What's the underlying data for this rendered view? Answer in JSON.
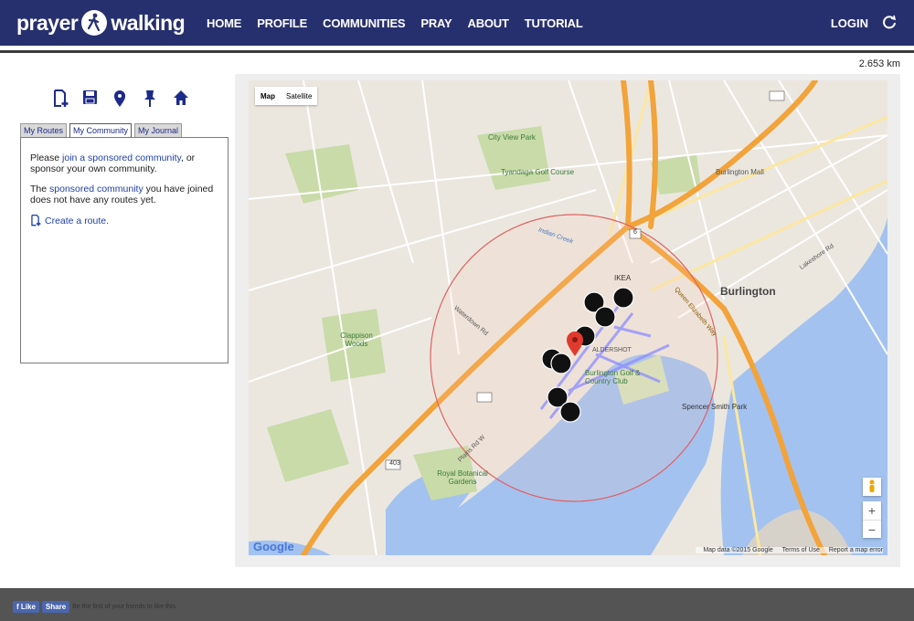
{
  "header": {
    "logo_left": "prayer",
    "logo_right": "walking",
    "nav": [
      "HOME",
      "PROFILE",
      "COMMUNITIES",
      "PRAY",
      "ABOUT",
      "TUTORIAL"
    ],
    "login": "LOGIN"
  },
  "distance": "2.653 km",
  "toolbar": [
    "new-route-icon",
    "save-icon",
    "map-pin-icon",
    "pushpin-icon",
    "home-icon"
  ],
  "tabs": [
    "My Routes",
    "My Community",
    "My Journal"
  ],
  "panel": {
    "p1_before": "Please ",
    "p1_link": "join a sponsored community",
    "p1_after": ", or sponsor your own community.",
    "p2_before": "The ",
    "p2_link": "sponsored community",
    "p2_after": " you have joined does not have any routes yet.",
    "create": "Create a route."
  },
  "map": {
    "type_map": "Map",
    "type_satellite": "Satellite",
    "zoom_in": "+",
    "zoom_out": "−",
    "google": "Google",
    "attribution": {
      "data": "Map data ©2015 Google",
      "terms": "Terms of Use",
      "report": "Report a map error"
    },
    "labels": {
      "burlington": "Burlington",
      "aldershot": "ALDERSHOT",
      "city_view_park": "City View Park",
      "tyandaga": "Tyandaga Golf Course",
      "burlington_mall": "Burlington Mall",
      "clappison_woods": "Clappison Woods",
      "burlington_golf": "Burlington Golf & Country Club",
      "spencer_smith": "Spencer Smith Park",
      "botanical": "Royal Botanical Gardens",
      "ikea": "IKEA",
      "indian_creek": "Indian Creek",
      "waterdown_rd": "Waterdown Rd",
      "qew": "Queen Elizabeth Way",
      "plains_rd_w": "Plains Rd W",
      "lakeshore_rd": "Lakeshore Rd",
      "hwy_403": "403",
      "hwy_6": "6"
    }
  },
  "colors": {
    "header": "#27306e",
    "water": "#a3c2f0",
    "highway": "#f2a33a",
    "park": "#c8dba8",
    "circle": "#e06060",
    "route": "#8c8cff"
  },
  "footer": {
    "like": "Like",
    "share": "Share",
    "text": "Be the first of your friends to like this."
  }
}
